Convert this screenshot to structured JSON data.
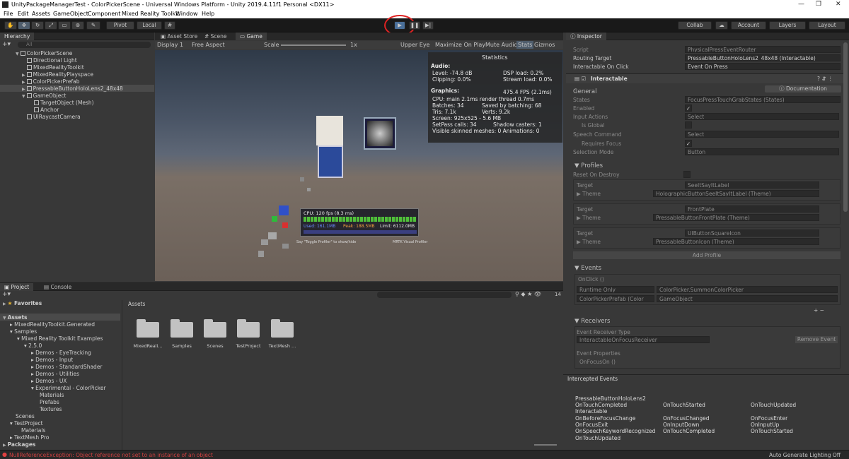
{
  "window": {
    "title": "UnityPackageManagerTest - ColorPickerScene - Universal Windows Platform - Unity 2019.4.11f1 Personal <DX11>"
  },
  "menu": [
    "File",
    "Edit",
    "Assets",
    "GameObject",
    "Component",
    "Mixed Reality Toolkit",
    "Window",
    "Help"
  ],
  "toolbar": {
    "pivot": "Pivot",
    "local": "Local",
    "collab": "Collab",
    "account": "Account",
    "layers": "Layers",
    "layout": "Layout"
  },
  "hierarchy": {
    "tab": "Hierarchy",
    "search_placeholder": "All",
    "items": [
      "ColorPickerScene",
      "Directional Light",
      "MixedRealityToolkit",
      "MixedRealityPlayspace",
      "ColorPickerPrefab",
      "PressableButtonHoloLens2_48x48",
      "GameObject",
      "TargetObject (Mesh)",
      "Anchor",
      "UIRaycastCamera"
    ]
  },
  "center_tabs": [
    "Asset Store",
    "Scene",
    "Game"
  ],
  "game_bar": {
    "display": "Display 1",
    "aspect": "Free Aspect",
    "scale_label": "Scale",
    "scale_value": "1x",
    "upper_eye": "Upper Eye",
    "maximize": "Maximize On Play",
    "mute": "Mute Audio",
    "stats": "Stats",
    "gizmos": "Gizmos"
  },
  "statistics": {
    "title": "Statistics",
    "audio": "Audio:",
    "level": "Level: -74.8 dB",
    "clipping": "Clipping: 0.0%",
    "dsp": "DSP load: 0.2%",
    "stream": "Stream load: 0.0%",
    "graphics": "Graphics:",
    "fps": "475.4 FPS (2.1ms)",
    "cpu": "CPU: main 2.1ms  render thread 0.7ms",
    "batches": "Batches: 34",
    "saved": "Saved by batching: 68",
    "tris": "Tris: 7.1k",
    "verts": "Verts: 9.2k",
    "screen": "Screen: 925x525 - 5.6 MB",
    "setpass": "SetPass calls: 34",
    "shadow": "Shadow casters: 1",
    "skinned": "Visible skinned meshes: 0  Animations: 0"
  },
  "profiler": {
    "cpu": "CPU: 120 fps (8.3 ms)",
    "used": "Used: 161.1MB",
    "peak": "Peak: 188.5MB",
    "limit": "Limit: 6112.0MB",
    "hint1": "Say \"Toggle Profiler\" to show/hide",
    "hint2": "MRTK Visual Profiler"
  },
  "inspector": {
    "tab": "Inspector",
    "script": "Script",
    "script_val": "PhysicalPressEventRouter",
    "routing": "Routing Target",
    "routing_val": "PressableButtonHoloLens2_48x48 (Interactable)",
    "onclick": "Interactable On Click",
    "onclick_val": "Event On Press",
    "component": "Interactable",
    "doc": "Documentation",
    "general": "General",
    "states": "States",
    "states_val": "FocusPressTouchGrabStates (States)",
    "enabled": "Enabled",
    "input_actions": "Input Actions",
    "select": "Select",
    "is_global": "Is Global",
    "speech": "Speech Command",
    "speech_val": "Select",
    "requires_focus": "Requires Focus",
    "selection_mode": "Selection Mode",
    "selection_val": "Button",
    "profiles": "Profiles",
    "reset": "Reset On Destroy",
    "target": "Target",
    "theme": "Theme",
    "p1_target": "SeeItSayItLabel",
    "p1_theme": "HolographicButtonSeeItSayItLabel (Theme)",
    "p2_target": "FrontPlate",
    "p2_theme": "PressableButtonFrontPlate (Theme)",
    "p3_target": "UIButtonSquareIcon",
    "p3_theme": "PressableButtonIcon (Theme)",
    "add_profile": "Add Profile",
    "events": "Events",
    "onclick_evt": "OnClick ()",
    "runtime": "Runtime Only",
    "method": "ColorPicker.SummonColorPicker",
    "obj": "ColorPickerPrefab (Color",
    "go": "GameObject",
    "receivers": "Receivers",
    "receiver_type": "Event Receiver Type",
    "receiver_val": "InteractableOnFocusReceiver",
    "remove": "Remove Event",
    "event_props": "Event Properties",
    "onfocuson": "OnFocusOn ()"
  },
  "intercepted": {
    "title": "Intercepted Events",
    "object": "PressableButtonHoloLens2",
    "row1": [
      "OnTouchCompleted",
      "OnTouchStarted",
      "OnTouchUpdated"
    ],
    "interactable": "Interactable",
    "row2": [
      "OnBeforeFocusChange",
      "OnFocusChanged",
      "OnFocusEnter"
    ],
    "row3": [
      "OnFocusExit",
      "OnInputDown",
      "OnInputUp"
    ],
    "row4": [
      "OnSpeechKeywordRecognized",
      "OnTouchCompleted",
      "OnTouchStarted"
    ],
    "row5": [
      "OnTouchUpdated"
    ]
  },
  "project": {
    "tabs": [
      "Project",
      "Console"
    ],
    "favorites": "Favorites",
    "assets_header": "Assets",
    "tree": [
      "Assets",
      "MixedRealityToolkit.Generated",
      "Samples",
      "Mixed Reality Toolkit Examples",
      "2.5.0",
      "Demos - EyeTracking",
      "Demos - Input",
      "Demos - StandardShader",
      "Demos - Utilities",
      "Demos - UX",
      "Experimental - ColorPicker",
      "Materials",
      "Prefabs",
      "Textures",
      "Scenes",
      "TestProject",
      "Materials",
      "TextMesh Pro",
      "Packages"
    ],
    "folders": [
      "MixedReali...",
      "Samples",
      "Scenes",
      "TestProject",
      "TextMesh ..."
    ],
    "count": "14"
  },
  "status": {
    "error": "NullReferenceException: Object reference not set to an instance of an object",
    "right": "Auto Generate Lighting Off"
  }
}
